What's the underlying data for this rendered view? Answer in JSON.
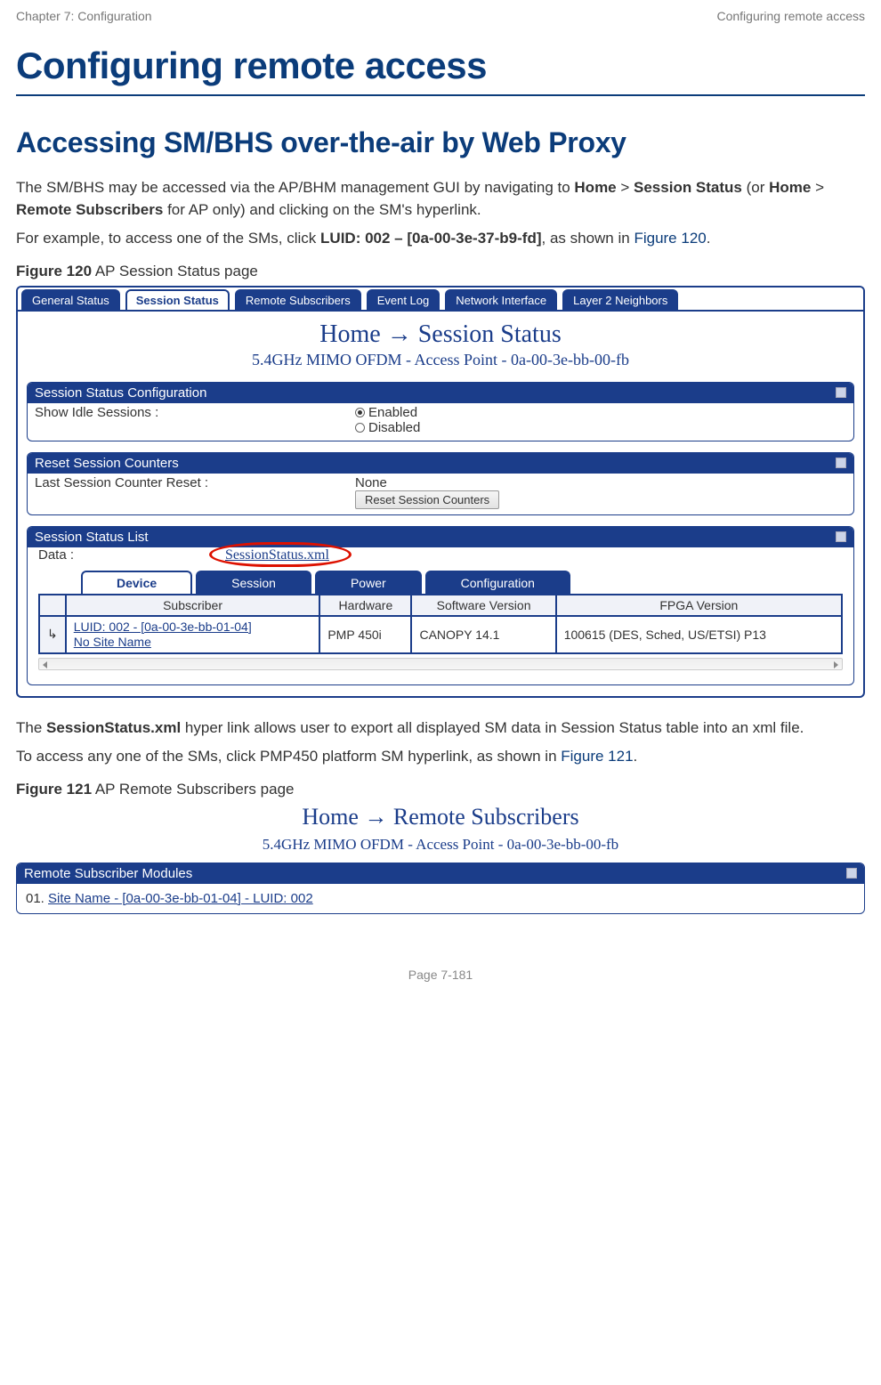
{
  "header": {
    "left": "Chapter 7:  Configuration",
    "right": "Configuring remote access"
  },
  "h1": "Configuring remote access",
  "h2": "Accessing SM/BHS over-the-air by Web Proxy",
  "p1_a": "The SM/BHS may be accessed via the AP/BHM management GUI by navigating to ",
  "p1_b": "Home",
  "p1_c": " > ",
  "p1_d": "Session Status",
  "p1_e": " (or ",
  "p1_f": "Home",
  "p1_g": " > ",
  "p1_h": "Remote Subscribers",
  "p1_i": " for AP only) and clicking on the SM's hyperlink.",
  "p2_a": "For example, to access one of the SMs, click ",
  "p2_b": "LUID: 002 – [0a-00-3e-37-b9-fd]",
  "p2_c": ", as shown in ",
  "p2_d": "Figure 120",
  "p2_e": ".",
  "cap120_a": "Figure 120",
  "cap120_b": " AP Session Status page",
  "fig120": {
    "tabs": [
      "General Status",
      "Session Status",
      "Remote Subscribers",
      "Event Log",
      "Network Interface",
      "Layer 2 Neighbors"
    ],
    "active_tab_index": 1,
    "title": "Home → Session Status",
    "subtitle": "5.4GHz MIMO OFDM - Access Point - 0a-00-3e-bb-00-fb",
    "panel1": {
      "header": "Session Status Configuration",
      "label": "Show Idle Sessions :",
      "opt_enabled": "Enabled",
      "opt_disabled": "Disabled"
    },
    "panel2": {
      "header": "Reset Session Counters",
      "label": "Last Session Counter Reset :",
      "value": "None",
      "button": "Reset Session Counters"
    },
    "panel3": {
      "header": "Session Status List",
      "data_label": "Data :",
      "data_link": "SessionStatus.xml",
      "inner_tabs": [
        "Device",
        "Session",
        "Power",
        "Configuration"
      ],
      "th1": "Subscriber",
      "th2": "Hardware",
      "th3": "Software Version",
      "th4": "FPGA Version",
      "row": {
        "sub_a": "LUID: 002 - [0a-00-3e-bb-01-04]",
        "sub_b": "No Site Name",
        "hw": "PMP 450i",
        "sw": "CANOPY 14.1",
        "fpga": "100615 (DES, Sched, US/ETSI) P13"
      }
    }
  },
  "p3_a": "The ",
  "p3_b": "SessionStatus.xml",
  "p3_c": " hyper link allows user to export all displayed SM data in Session Status table into an xml file.",
  "p4_a": "To access any one of the SMs, click PMP450 platform SM hyperlink, as shown in ",
  "p4_b": "Figure 121",
  "p4_c": ".",
  "cap121_a": "Figure 121",
  "cap121_b": " AP Remote Subscribers page",
  "fig121": {
    "title": "Home → Remote Subscribers",
    "subtitle": "5.4GHz MIMO OFDM - Access Point - 0a-00-3e-bb-00-fb",
    "panel_header": "Remote Subscriber Modules",
    "item_num": "01.",
    "item_link": "Site Name - [0a-00-3e-bb-01-04] - LUID: 002"
  },
  "footer": "Page 7-181"
}
